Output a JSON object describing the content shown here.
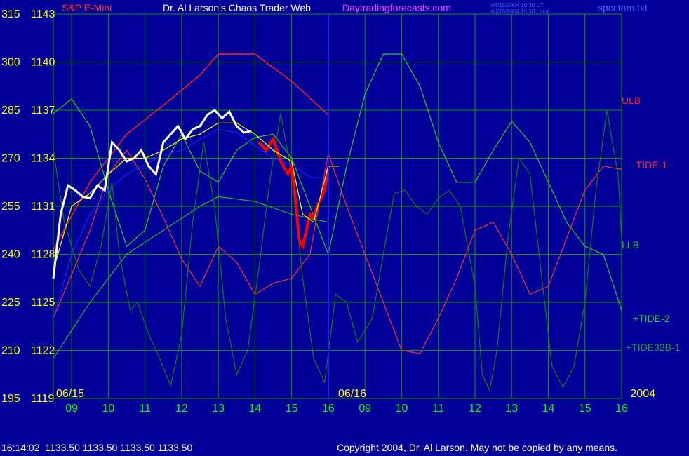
{
  "header": {
    "instrument": "S&P E-Mini",
    "title": "Dr. Al Larson's Chaos Trader Web",
    "site": "Daytradingforecasts.com",
    "time_ut": "06/15/2004 20:30 UT",
    "time_local": "06/15/2004 15:30 Local",
    "file": "spcctom.txt"
  },
  "status": {
    "time": "16:14:02",
    "open": "1133.50",
    "high": "1133.50",
    "low": "1133.50",
    "close": "1133.50"
  },
  "copyright": "Copyright 2004, Dr. Al Larson. May not be copied by any means.",
  "colors": {
    "background": "#000099",
    "grid": "#00a000",
    "price_white": "#ffffff",
    "price_red": "#ff0000",
    "ulb": "#ff2020",
    "tide1": "#ff3030",
    "llb": "#20c020",
    "tide2": "#20d020",
    "tide32": "#108010",
    "blue_line": "#2020ff",
    "yellow_avg": "#ffff00",
    "date_label": "#ffff00",
    "hour_label": "#00ff00",
    "axis_label": "#ffff00"
  },
  "chart_data": {
    "type": "line",
    "left_axis_ticks": [
      "315",
      "300",
      "285",
      "270",
      "255",
      "240",
      "225",
      "210",
      "195"
    ],
    "price_ticks": [
      "1143",
      "1140",
      "1137",
      "1134",
      "1131",
      "1128",
      "1125",
      "1122",
      "1119"
    ],
    "price_range": [
      1119,
      1143
    ],
    "x_hours": [
      "09",
      "10",
      "11",
      "12",
      "13",
      "14",
      "15",
      "16",
      "09",
      "10",
      "11",
      "12",
      "13",
      "14",
      "15",
      "16"
    ],
    "date_labels": [
      "06/15",
      "06/16",
      "2004"
    ],
    "series_labels": [
      {
        "name": "ULB",
        "color": "#ff2020"
      },
      {
        "name": "-TIDE-1",
        "color": "#ff3030"
      },
      {
        "name": "LLB",
        "color": "#20d020"
      },
      {
        "name": "+TIDE-2",
        "color": "#20d020"
      },
      {
        "name": "+TIDE32B-1",
        "color": "#20a020"
      }
    ],
    "ulb": [
      [
        8.5,
        1128.3
      ],
      [
        9.5,
        1132.5
      ],
      [
        10.5,
        1135.5
      ],
      [
        11.5,
        1137.3
      ],
      [
        12.5,
        1139.2
      ],
      [
        13.0,
        1140.5
      ],
      [
        14.0,
        1140.5
      ],
      [
        15.0,
        1138.8
      ],
      [
        16.0,
        1136.7
      ]
    ],
    "llb": [
      [
        8.5,
        1121.5
      ],
      [
        9.5,
        1125.0
      ],
      [
        10.5,
        1128.0
      ],
      [
        11.5,
        1129.5
      ],
      [
        12.5,
        1131.0
      ],
      [
        13.0,
        1131.6
      ],
      [
        14.0,
        1131.3
      ],
      [
        15.0,
        1130.5
      ],
      [
        16.0,
        1130.0
      ]
    ],
    "minus_tide_1": [
      [
        8.5,
        1124.0
      ],
      [
        9.5,
        1129.5
      ],
      [
        10.0,
        1133.0
      ],
      [
        10.5,
        1134.5
      ],
      [
        11.0,
        1132.7
      ],
      [
        11.5,
        1130.3
      ],
      [
        12.0,
        1127.7
      ],
      [
        12.5,
        1126.0
      ],
      [
        13.0,
        1128.5
      ],
      [
        13.5,
        1127.5
      ],
      [
        14.0,
        1125.5
      ],
      [
        14.5,
        1126.2
      ],
      [
        15.0,
        1126.5
      ],
      [
        15.5,
        1128.0
      ],
      [
        16.0,
        1134.3
      ],
      [
        16.5,
        1131.0
      ],
      [
        17.0,
        1128.0
      ],
      [
        17.5,
        1125.0
      ],
      [
        18.0,
        1122.0
      ],
      [
        18.5,
        1121.8
      ],
      [
        19.0,
        1124.0
      ],
      [
        19.5,
        1126.5
      ],
      [
        20.0,
        1129.5
      ],
      [
        20.5,
        1130.0
      ],
      [
        21.0,
        1128.0
      ],
      [
        21.5,
        1125.5
      ],
      [
        22.0,
        1126.0
      ],
      [
        22.5,
        1129.0
      ],
      [
        23.0,
        1132.0
      ],
      [
        23.5,
        1133.5
      ],
      [
        24.0,
        1133.3
      ]
    ],
    "plus_tide_2": [
      [
        8.5,
        1136.8
      ],
      [
        9.0,
        1137.7
      ],
      [
        9.5,
        1136.0
      ],
      [
        10.0,
        1132.0
      ],
      [
        10.5,
        1128.5
      ],
      [
        11.0,
        1129.5
      ],
      [
        11.5,
        1133.5
      ],
      [
        12.0,
        1135.5
      ],
      [
        12.5,
        1133.2
      ],
      [
        13.0,
        1132.5
      ],
      [
        13.5,
        1134.5
      ],
      [
        14.0,
        1135.3
      ],
      [
        14.5,
        1135.5
      ],
      [
        15.0,
        1134.0
      ],
      [
        15.5,
        1131.0
      ],
      [
        16.0,
        1128.0
      ],
      [
        16.5,
        1133.5
      ],
      [
        17.0,
        1138.0
      ],
      [
        17.5,
        1140.5
      ],
      [
        18.0,
        1140.5
      ],
      [
        18.5,
        1138.5
      ],
      [
        19.0,
        1135.0
      ],
      [
        19.5,
        1132.5
      ],
      [
        20.0,
        1132.5
      ],
      [
        20.5,
        1134.5
      ],
      [
        21.0,
        1136.3
      ],
      [
        21.5,
        1135.0
      ],
      [
        22.0,
        1132.5
      ],
      [
        22.5,
        1130.0
      ],
      [
        23.0,
        1128.5
      ],
      [
        23.5,
        1128.0
      ],
      [
        24.0,
        1124.5
      ]
    ],
    "plus_tide32b_1": [
      [
        8.5,
        1134.5
      ],
      [
        8.8,
        1130.0
      ],
      [
        9.2,
        1127.0
      ],
      [
        9.5,
        1126.0
      ],
      [
        9.8,
        1128.5
      ],
      [
        10.1,
        1132.5
      ],
      [
        10.3,
        1128.0
      ],
      [
        10.6,
        1124.5
      ],
      [
        10.8,
        1125.0
      ],
      [
        11.1,
        1123.0
      ],
      [
        11.4,
        1121.5
      ],
      [
        11.7,
        1119.8
      ],
      [
        12.0,
        1123.0
      ],
      [
        12.3,
        1130.0
      ],
      [
        12.6,
        1135.0
      ],
      [
        12.9,
        1131.0
      ],
      [
        13.2,
        1124.0
      ],
      [
        13.5,
        1120.5
      ],
      [
        13.8,
        1122.0
      ],
      [
        14.1,
        1127.0
      ],
      [
        14.4,
        1132.5
      ],
      [
        14.7,
        1136.8
      ],
      [
        15.0,
        1133.0
      ],
      [
        15.3,
        1126.5
      ],
      [
        15.6,
        1121.5
      ],
      [
        15.9,
        1120.0
      ],
      [
        16.2,
        1125.5
      ],
      [
        16.5,
        1125.0
      ],
      [
        16.8,
        1122.5
      ],
      [
        17.2,
        1124.0
      ],
      [
        17.5,
        1128.0
      ],
      [
        17.8,
        1131.8
      ],
      [
        18.1,
        1132.0
      ],
      [
        18.4,
        1131.0
      ],
      [
        18.7,
        1130.5
      ],
      [
        19.0,
        1131.5
      ],
      [
        19.3,
        1132.0
      ],
      [
        19.6,
        1131.0
      ],
      [
        20.0,
        1126.0
      ],
      [
        20.2,
        1120.5
      ],
      [
        20.4,
        1119.5
      ],
      [
        20.6,
        1122.0
      ],
      [
        20.9,
        1129.0
      ],
      [
        21.2,
        1134.0
      ],
      [
        21.5,
        1133.0
      ],
      [
        21.8,
        1127.0
      ],
      [
        22.1,
        1121.0
      ],
      [
        22.4,
        1119.7
      ],
      [
        22.7,
        1121.0
      ],
      [
        23.0,
        1125.0
      ],
      [
        23.3,
        1132.0
      ],
      [
        23.6,
        1137.0
      ],
      [
        23.9,
        1133.0
      ],
      [
        24.0,
        1129.0
      ]
    ],
    "blue_line": [
      [
        8.5,
        1124.0
      ],
      [
        9.0,
        1128.0
      ],
      [
        9.5,
        1130.5
      ],
      [
        10.0,
        1132.0
      ],
      [
        10.5,
        1133.0
      ],
      [
        11.0,
        1133.6
      ],
      [
        11.5,
        1134.2
      ],
      [
        12.0,
        1134.5
      ],
      [
        12.5,
        1135.2
      ],
      [
        13.0,
        1135.8
      ],
      [
        13.5,
        1135.6
      ],
      [
        14.0,
        1134.8
      ],
      [
        14.5,
        1134.0
      ],
      [
        15.0,
        1133.6
      ],
      [
        15.5,
        1132.8
      ],
      [
        16.0,
        1132.8
      ]
    ],
    "price": [
      [
        8.5,
        1126.5
      ],
      [
        8.7,
        1130.5
      ],
      [
        8.9,
        1132.3
      ],
      [
        9.1,
        1132.0
      ],
      [
        9.3,
        1131.6
      ],
      [
        9.5,
        1131.5
      ],
      [
        9.7,
        1132.3
      ],
      [
        9.9,
        1132.0
      ],
      [
        10.1,
        1135.0
      ],
      [
        10.3,
        1134.5
      ],
      [
        10.5,
        1133.8
      ],
      [
        10.7,
        1134.0
      ],
      [
        10.9,
        1134.5
      ],
      [
        11.1,
        1133.5
      ],
      [
        11.3,
        1133.0
      ],
      [
        11.5,
        1135.0
      ],
      [
        11.7,
        1135.5
      ],
      [
        11.9,
        1136.0
      ],
      [
        12.1,
        1135.2
      ],
      [
        12.3,
        1135.8
      ],
      [
        12.5,
        1136.0
      ],
      [
        12.7,
        1136.7
      ],
      [
        12.9,
        1137.0
      ],
      [
        13.1,
        1136.5
      ],
      [
        13.3,
        1136.9
      ],
      [
        13.5,
        1136.0
      ],
      [
        13.7,
        1135.6
      ],
      [
        13.9,
        1135.7
      ],
      [
        14.1,
        1135.0
      ],
      [
        14.3,
        1134.5
      ],
      [
        14.5,
        1135.2
      ],
      [
        14.7,
        1133.8
      ],
      [
        14.9,
        1133.0
      ],
      [
        15.0,
        1133.5
      ],
      [
        15.1,
        1131.5
      ],
      [
        15.2,
        1129.0
      ],
      [
        15.3,
        1128.5
      ],
      [
        15.4,
        1129.5
      ],
      [
        15.5,
        1130.5
      ],
      [
        15.6,
        1130.3
      ],
      [
        15.7,
        1131.0
      ],
      [
        15.8,
        1131.5
      ],
      [
        15.9,
        1132.0
      ],
      [
        16.0,
        1133.5
      ]
    ],
    "price_red_from": 14.0,
    "yellow_avg": [
      [
        8.5,
        1127.0
      ],
      [
        9.0,
        1131.0
      ],
      [
        9.5,
        1131.8
      ],
      [
        10.0,
        1133.0
      ],
      [
        10.5,
        1134.0
      ],
      [
        11.0,
        1134.0
      ],
      [
        11.5,
        1134.5
      ],
      [
        12.0,
        1135.2
      ],
      [
        12.5,
        1135.5
      ],
      [
        13.0,
        1136.2
      ],
      [
        13.5,
        1136.2
      ],
      [
        14.0,
        1135.5
      ],
      [
        14.5,
        1134.5
      ],
      [
        15.0,
        1133.8
      ],
      [
        15.3,
        1130.5
      ],
      [
        15.6,
        1130.0
      ],
      [
        16.0,
        1133.5
      ],
      [
        16.3,
        1133.5
      ]
    ]
  }
}
